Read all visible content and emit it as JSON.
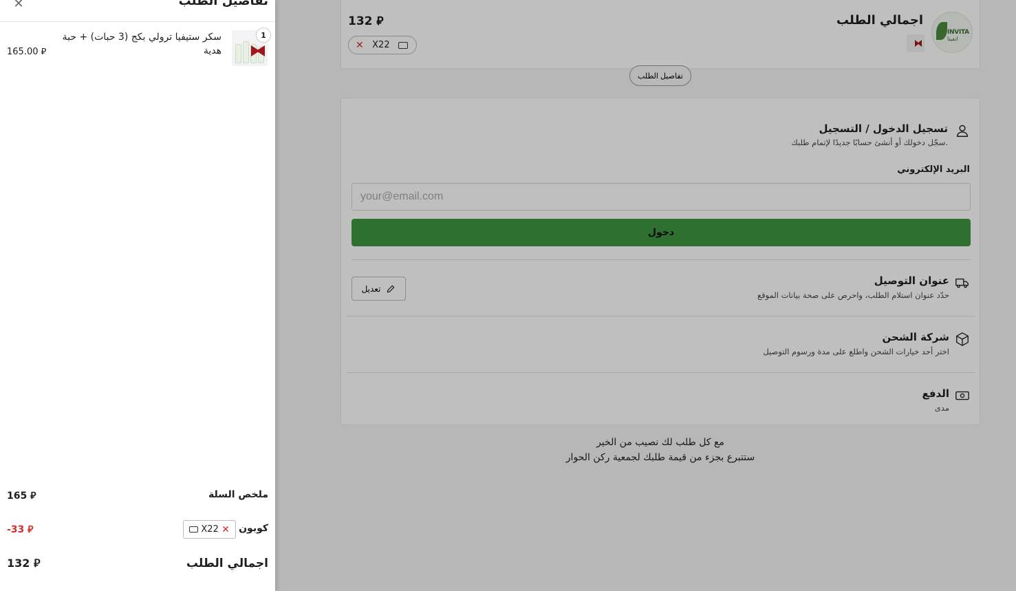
{
  "currency_symbol": "⃁",
  "checkout": {
    "summary": {
      "title": "اجمالي الطلب",
      "total": "132 ⃁",
      "logo_text": "INVITA",
      "logo_text_ar": "انفيتا",
      "coupon_code": "X22",
      "remove_icon": "close-icon"
    },
    "details_button": "تفاصيل الطلب",
    "login": {
      "title": "تسجيل الدخول / التسجيل",
      "subtitle": "سجّل دخولك أو أنشئ حسابًا جديدًا لإتمام طلبك.",
      "email_label": "البريد الإلكتروني",
      "email_placeholder": "your@email.com",
      "email_value": "",
      "submit_label": "دخول",
      "icon": "user-icon"
    },
    "address": {
      "title": "عنوان التوصيل",
      "subtitle": "حدّد عنوان استلام الطلب، واحرص على صحة بيانات الموقع",
      "edit_label": "تعديل",
      "icon": "delivery-truck-icon"
    },
    "shipping": {
      "title": "شركة الشحن",
      "subtitle": "اختر أحد خيارات الشحن واطلع على مدة ورسوم التوصيل",
      "icon": "box-icon"
    },
    "payment": {
      "title": "الدفع",
      "subtitle": "مدى",
      "icon": "cash-icon"
    },
    "donation": {
      "line1": "مع كل طلب لك نصيب من الخير",
      "line2": "ستتبرع بجزء من قيمة طلبك لجمعية ركن الحوار"
    }
  },
  "drawer": {
    "title": "تفاصيل الطلب",
    "items": [
      {
        "name": "سكر ستيفيا ترولي بكج (3 حبات) + حبة هدية",
        "price": "165.00 ⃁",
        "quantity": "1"
      }
    ],
    "cart_summary_label": "ملخص السلة",
    "cart_summary_value": "165 ⃁",
    "coupon_label": "كوبون",
    "coupon_code": "X22",
    "coupon_discount": "-33 ⃁",
    "total_label": "اجمالي الطلب",
    "total_value": "132 ⃁"
  },
  "colors": {
    "primary_button": "#3f9642",
    "discount": "#d32f2f",
    "overlay": "rgba(0,0,0,0.25)"
  }
}
